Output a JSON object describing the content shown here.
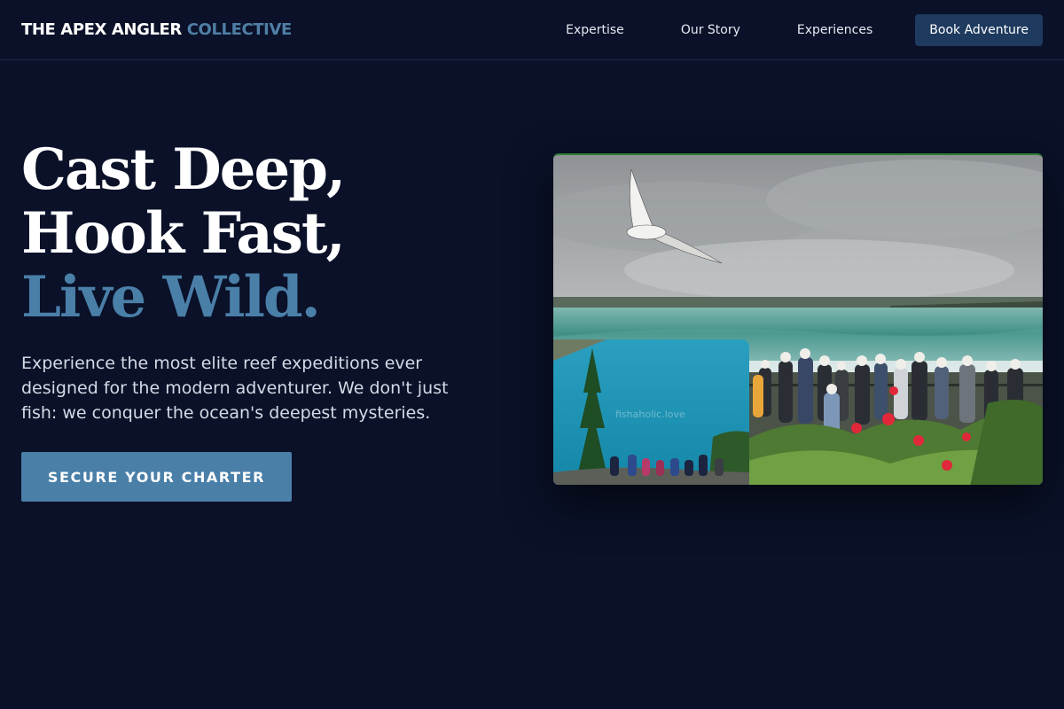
{
  "brand": {
    "part1": "THE APEX ANGLER",
    "part2": "COLLECTIVE"
  },
  "nav": {
    "links": [
      "Expertise",
      "Our Story",
      "Experiences"
    ],
    "cta": "Book Adventure"
  },
  "hero": {
    "line1": "Cast Deep,",
    "line2": "Hook Fast,",
    "line3": "Live Wild.",
    "subtitle": "Experience the most elite reef expeditions ever designed for the modern adventurer. We don't just fish: we conquer the ocean's deepest mysteries.",
    "cta": "SECURE YOUR CHARTER"
  },
  "photo": {
    "watermark": "fishaholic.love"
  },
  "colors": {
    "background": "#0a1128",
    "accent": "#4a7fa8",
    "nav_button": "#1e3a5f"
  }
}
